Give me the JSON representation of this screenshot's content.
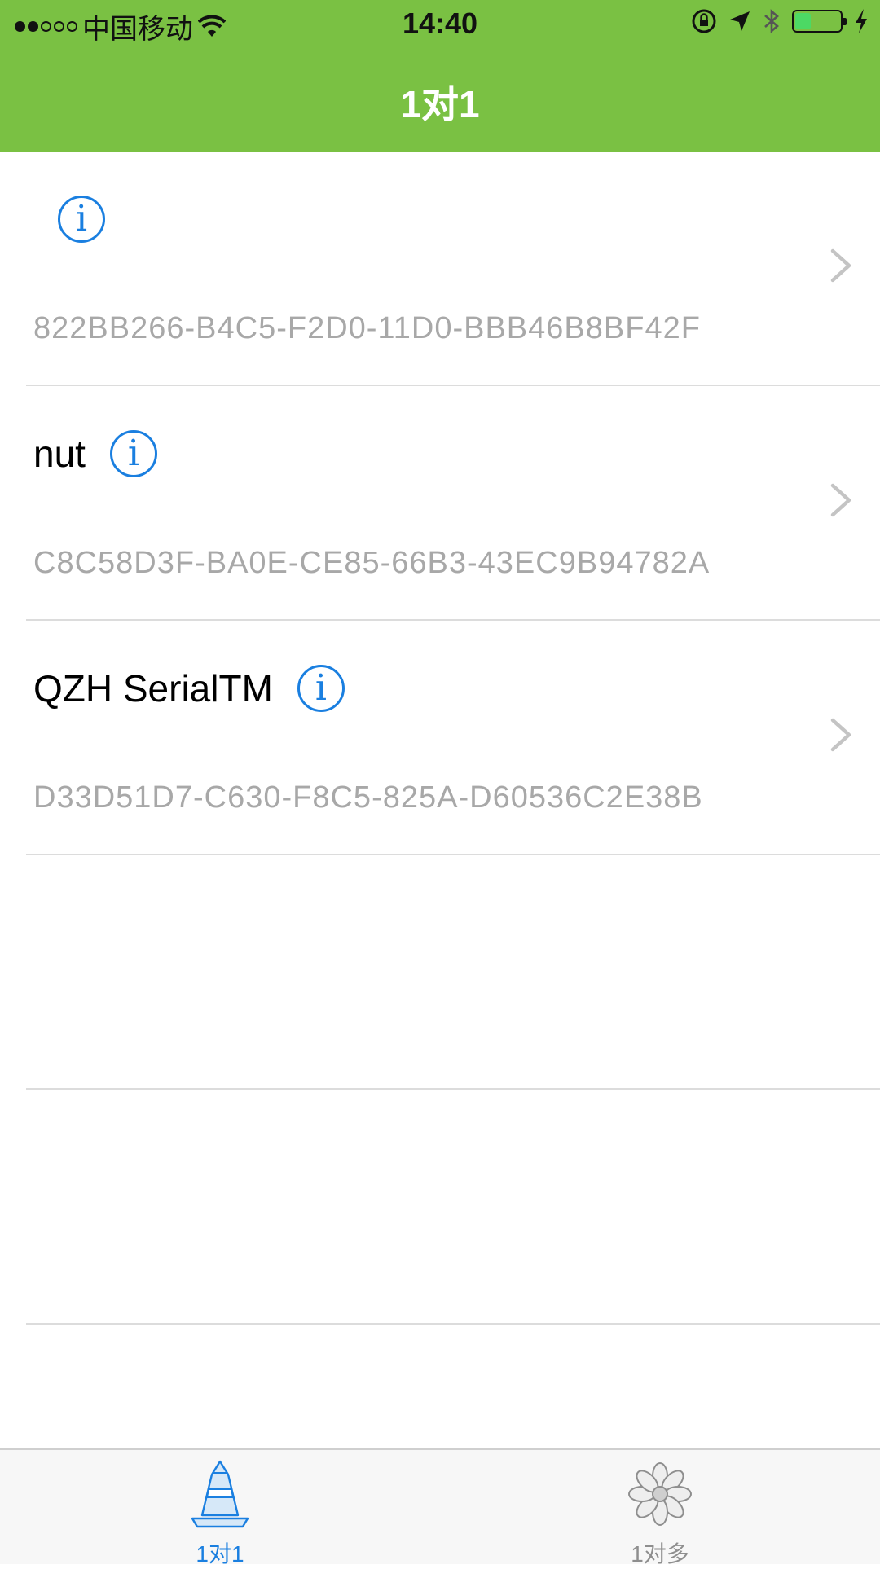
{
  "status_bar": {
    "carrier": "中国移动",
    "time": "14:40",
    "battery_level": 0.35,
    "signal_dots": [
      true,
      true,
      false,
      false,
      false
    ]
  },
  "nav": {
    "title": "1对1"
  },
  "devices": [
    {
      "name": "",
      "uuid": "822BB266-B4C5-F2D0-11D0-BBB46B8BF42F"
    },
    {
      "name": "nut",
      "uuid": "C8C58D3F-BA0E-CE85-66B3-43EC9B94782A"
    },
    {
      "name": "QZH SerialTM",
      "uuid": "D33D51D7-C630-F8C5-825A-D60536C2E38B"
    }
  ],
  "tabs": [
    {
      "label": "1对1",
      "icon": "traffic-cone-icon",
      "active": true
    },
    {
      "label": "1对多",
      "icon": "flower-icon",
      "active": false
    }
  ],
  "colors": {
    "accent": "#7ac143",
    "info_blue": "#1a7fe0",
    "uuid_gray": "#a8a8a8"
  }
}
